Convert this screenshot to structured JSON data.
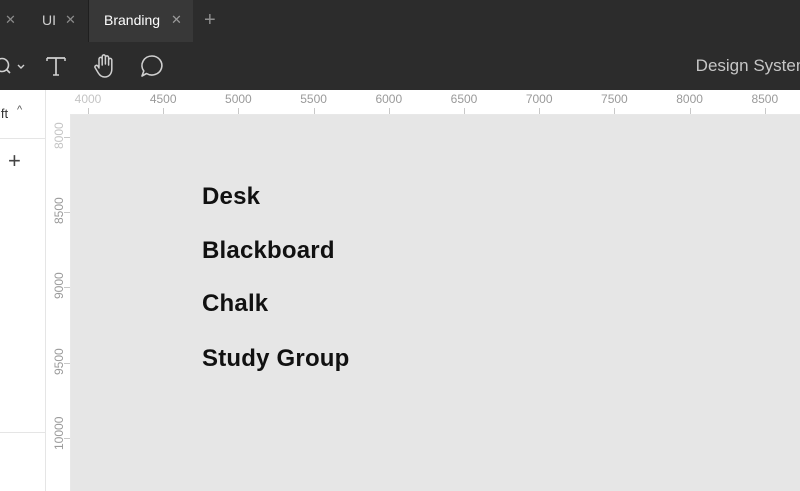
{
  "tabs": [
    {
      "label": "UI"
    },
    {
      "label": "Branding",
      "active": true
    }
  ],
  "tab_add_label": "+",
  "toolbar": {
    "document_title": "Design System"
  },
  "left_panel": {
    "label": "ift",
    "add_label": "+"
  },
  "ruler_x": [
    "4000",
    "4500",
    "5000",
    "5500",
    "6000",
    "6500",
    "7000",
    "7500",
    "8000",
    "8500"
  ],
  "ruler_y": [
    "8000",
    "8500",
    "9000",
    "9500",
    "10000"
  ],
  "canvas": {
    "layers": [
      "Desk",
      "Blackboard",
      "Chalk",
      "Study Group"
    ]
  },
  "colors": {
    "chrome_dark": "#2c2c2c",
    "active_tab": "#383838",
    "canvas_bg": "#e6e6e6",
    "text_dark": "#111111"
  }
}
